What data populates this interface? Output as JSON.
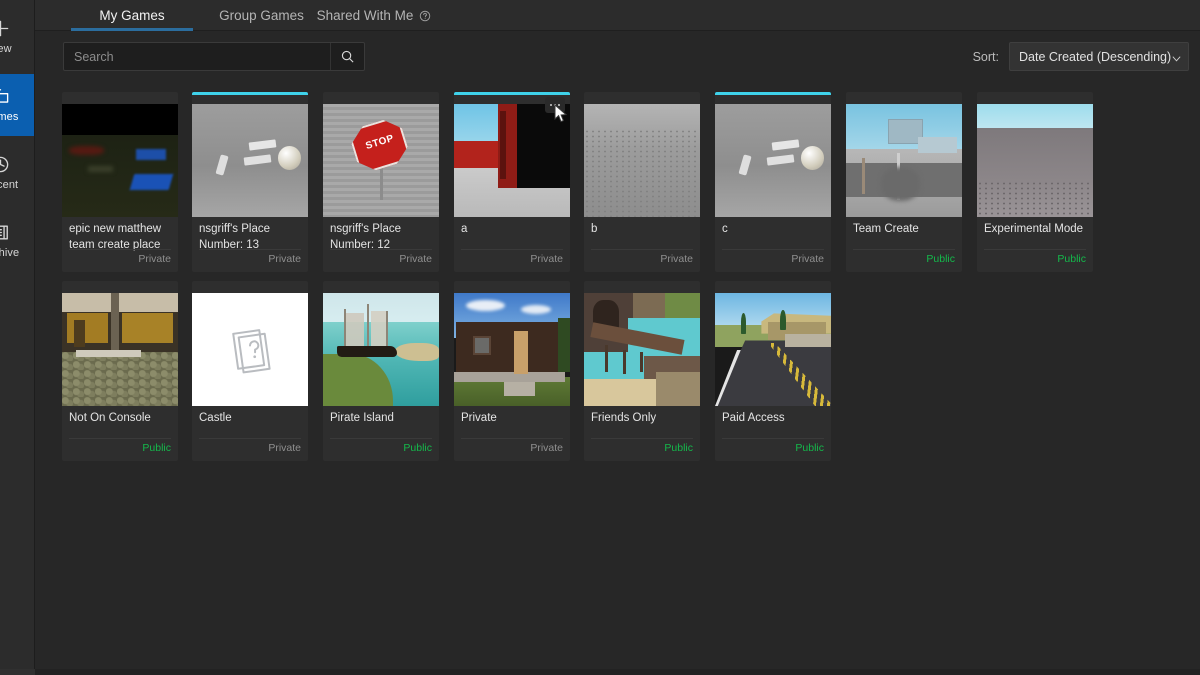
{
  "sidebar": {
    "items": [
      {
        "label": "New",
        "icon": "plus-icon",
        "active": false
      },
      {
        "label": "Games",
        "icon": "folder-icon",
        "active": true
      },
      {
        "label": "Recent",
        "icon": "clock-icon",
        "active": false
      },
      {
        "label": "Archive",
        "icon": "archive-icon",
        "active": false
      }
    ]
  },
  "tabs": [
    {
      "label": "My Games",
      "active": true,
      "help": false
    },
    {
      "label": "Group Games",
      "active": false,
      "help": false
    },
    {
      "label": "Shared With Me",
      "active": false,
      "help": true
    }
  ],
  "toolbar": {
    "search_placeholder": "Search",
    "search_value": "",
    "search_icon": "search-icon",
    "sort_label": "Sort:",
    "sort_value": "Date Created (Descending)",
    "sort_options": [
      "Date Created (Descending)"
    ]
  },
  "colors": {
    "page_bg": "#272727",
    "card_bg": "#2e2e2e",
    "sidebar_active": "#0b5fb0",
    "tab_underline": "#2b6d9e",
    "public_green": "#14b84b",
    "private_grey": "#8f8f8f",
    "card_topbar_cyan": "#3fd2ea"
  },
  "games": [
    {
      "title": "epic new matthew team create place",
      "status": "Private",
      "topbar": false,
      "thumb": "dark-terrain"
    },
    {
      "title": "nsgriff's Place Number: 13",
      "status": "Private",
      "topbar": true,
      "thumb": "grey-parts"
    },
    {
      "title": "nsgriff's Place Number: 12",
      "status": "Private",
      "topbar": false,
      "thumb": "stop-sign"
    },
    {
      "title": "a",
      "status": "Private",
      "topbar": true,
      "thumb": "red-wall",
      "hovered": true,
      "more_button": "more-options-icon"
    },
    {
      "title": "b",
      "status": "Private",
      "topbar": false,
      "thumb": "grey-baseplate"
    },
    {
      "title": "c",
      "status": "Private",
      "topbar": true,
      "thumb": "grey-parts"
    },
    {
      "title": "Team Create",
      "status": "Public",
      "topbar": false,
      "thumb": "city-street"
    },
    {
      "title": "Experimental Mode",
      "status": "Public",
      "topbar": false,
      "thumb": "grey-horizon"
    },
    {
      "title": "Not On Console",
      "status": "Public",
      "topbar": false,
      "thumb": "stone-building"
    },
    {
      "title": "Castle",
      "status": "Private",
      "topbar": false,
      "thumb": "placeholder"
    },
    {
      "title": "Pirate Island",
      "status": "Public",
      "topbar": false,
      "thumb": "pirate-ship"
    },
    {
      "title": "Private",
      "status": "Private",
      "topbar": false,
      "thumb": "brown-house"
    },
    {
      "title": "Friends Only",
      "status": "Public",
      "topbar": false,
      "thumb": "canyon-bridge"
    },
    {
      "title": "Paid Access",
      "status": "Public",
      "topbar": false,
      "thumb": "suburb-road"
    }
  ]
}
